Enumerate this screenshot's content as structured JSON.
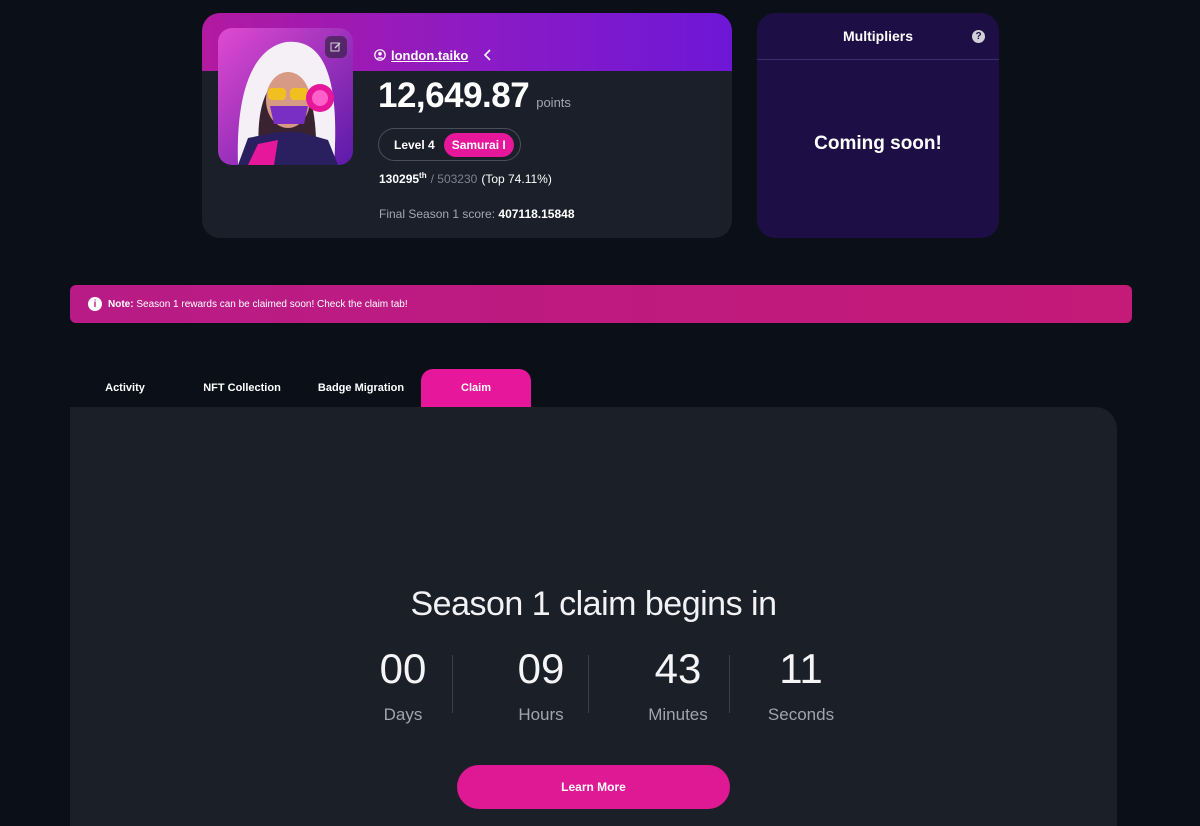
{
  "profile": {
    "username": "london.taiko",
    "points_value": "12,649.87",
    "points_unit": "points",
    "level_label": "Level 4",
    "rank_badge": "Samurai I",
    "rank_position": "130295",
    "rank_suffix": "th",
    "rank_total": "/ 503230",
    "rank_top": "(Top 74.11%)",
    "season_label": "Final Season 1 score:",
    "season_score": "407118.15848"
  },
  "multipliers": {
    "title": "Multipliers",
    "help_icon": "?",
    "coming_soon": "Coming soon!"
  },
  "note": {
    "icon": "i",
    "label": "Note:",
    "text": "Season 1 rewards can be claimed soon! Check the claim tab!"
  },
  "tabs": [
    {
      "label": "Activity",
      "active": false
    },
    {
      "label": "NFT Collection",
      "active": false
    },
    {
      "label": "Badge Migration",
      "active": false
    },
    {
      "label": "Claim",
      "active": true
    }
  ],
  "claim": {
    "title": "Season 1 claim begins in",
    "countdown": [
      {
        "value": "00",
        "label": "Days"
      },
      {
        "value": "09",
        "label": "Hours"
      },
      {
        "value": "43",
        "label": "Minutes"
      },
      {
        "value": "11",
        "label": "Seconds"
      }
    ],
    "button_label": "Learn More"
  },
  "colors": {
    "accent": "#e6179a",
    "background": "#0b0f17",
    "card": "#1b1f2a",
    "multipliers_card": "#1d0f45"
  }
}
